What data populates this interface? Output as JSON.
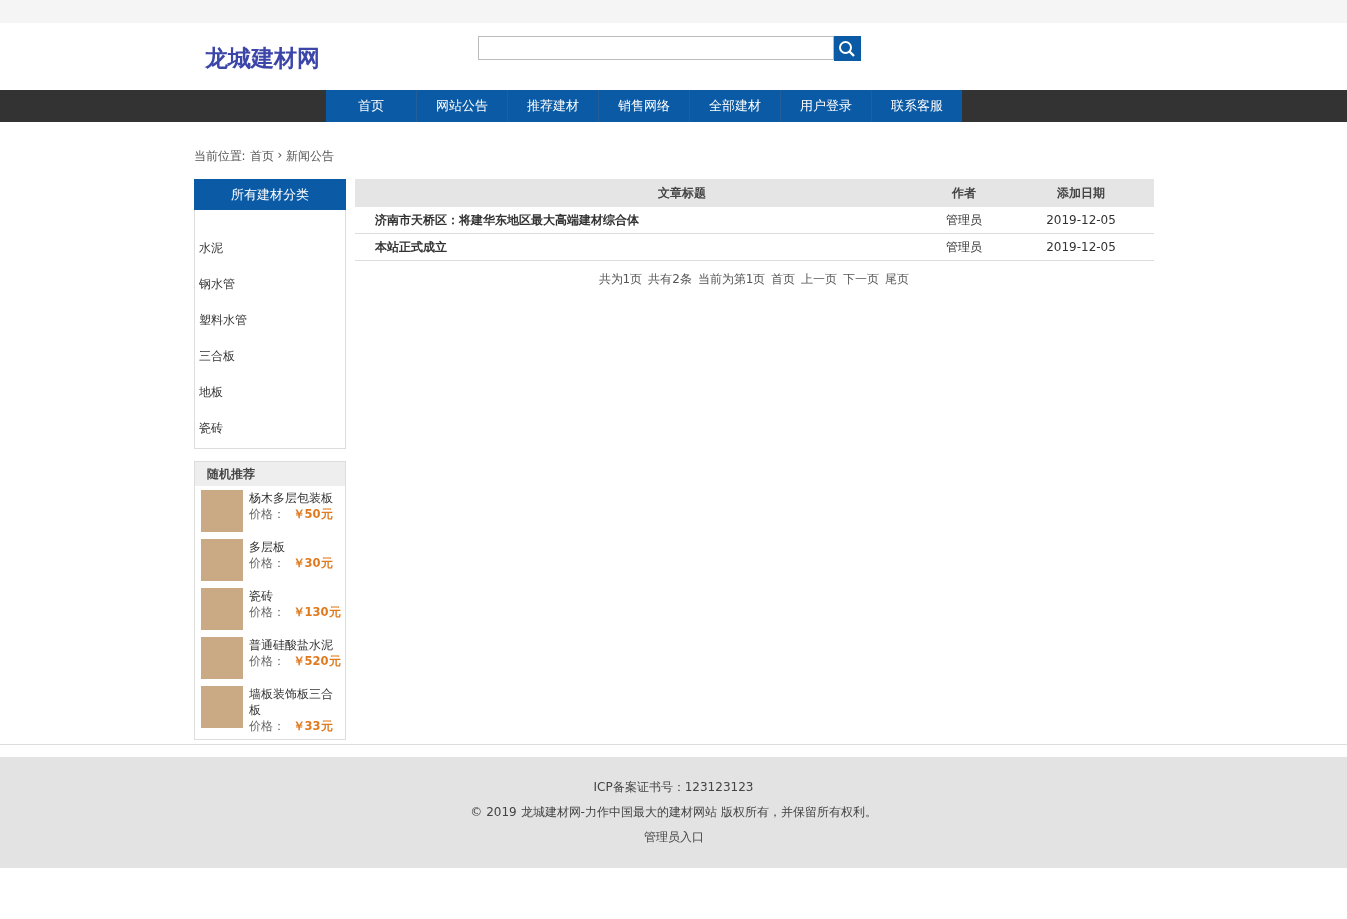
{
  "header": {
    "logo": "龙城建材网"
  },
  "nav": [
    {
      "label": "首页"
    },
    {
      "label": "网站公告"
    },
    {
      "label": "推荐建材"
    },
    {
      "label": "销售网络"
    },
    {
      "label": "全部建材"
    },
    {
      "label": "用户登录"
    },
    {
      "label": "联系客服"
    }
  ],
  "breadcrumb": {
    "label": "当前位置:",
    "items": [
      "首页",
      "›",
      "新闻公告"
    ]
  },
  "sidebar": {
    "title": "所有建材分类",
    "categories": [
      "水泥",
      "钢水管",
      "塑料水管",
      "三合板",
      "地板",
      "瓷砖"
    ],
    "recommend": {
      "title": "随机推荐",
      "items": [
        {
          "name": "杨木多层包装板",
          "price_label": "价格：",
          "price": "￥50元"
        },
        {
          "name": "多层板",
          "price_label": "价格：",
          "price": "￥30元"
        },
        {
          "name": "瓷砖",
          "price_label": "价格：",
          "price": "￥130元"
        },
        {
          "name": "普通硅酸盐水泥",
          "price_label": "价格：",
          "price": "￥520元"
        },
        {
          "name": "墙板装饰板三合板",
          "price_label": "价格：",
          "price": "￥33元"
        }
      ]
    }
  },
  "table": {
    "columns": [
      "文章标题",
      "作者",
      "添加日期"
    ],
    "rows": [
      {
        "title": "济南市天桥区：将建华东地区最大高端建材综合体",
        "author": "管理员",
        "date": "2019-12-05"
      },
      {
        "title": "本站正式成立",
        "author": "管理员",
        "date": "2019-12-05"
      }
    ]
  },
  "pagination": [
    "共为1页",
    "共有2条",
    "当前为第1页",
    "首页",
    "上一页",
    "下一页",
    "尾页"
  ],
  "footer": {
    "icp": "ICP备案证书号：123123123",
    "copyright": "© 2019 龙城建材网-力作中国最大的建材网站 版权所有，并保留所有权利。",
    "admin_link": "管理员入口"
  }
}
